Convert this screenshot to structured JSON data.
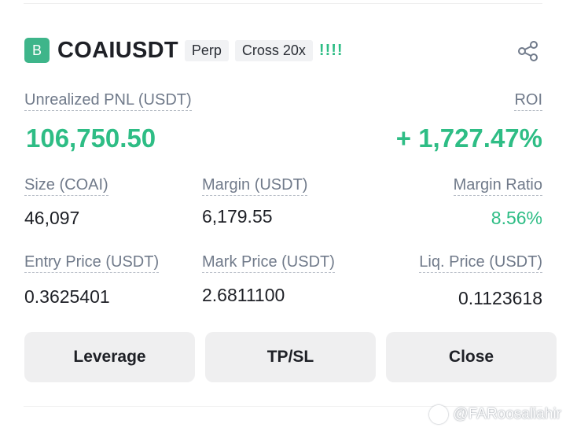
{
  "position": {
    "side_badge": "B",
    "symbol": "COAIUSDT",
    "contract_type": "Perp",
    "margin_mode": "Cross 20x",
    "risk_indicator": "!!!!"
  },
  "pnl": {
    "label": "Unrealized PNL (USDT)",
    "value": "106,750.50",
    "roi_label": "ROI",
    "roi_value": "+ 1,727.47%"
  },
  "stats": {
    "size_label": "Size (COAI)",
    "size_value": "46,097",
    "margin_label": "Margin (USDT)",
    "margin_value": "6,179.55",
    "margin_ratio_label": "Margin Ratio",
    "margin_ratio_value": "8.56%",
    "entry_label": "Entry Price (USDT)",
    "entry_value": "0.3625401",
    "mark_label": "Mark Price (USDT)",
    "mark_value": "2.6811100",
    "liq_label": "Liq. Price (USDT)",
    "liq_value": "0.1123618"
  },
  "actions": {
    "leverage": "Leverage",
    "tpsl": "TP/SL",
    "close": "Close"
  },
  "icons": {
    "share": "share-icon"
  },
  "colors": {
    "profit_green": "#2ebd85",
    "badge_green": "#3eb58a"
  },
  "watermark": "@FARoosaliahir"
}
